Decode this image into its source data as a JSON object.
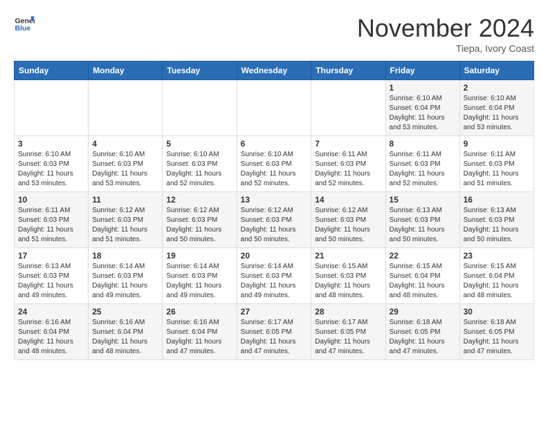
{
  "header": {
    "logo_general": "General",
    "logo_blue": "Blue",
    "month_title": "November 2024",
    "location": "Tiepa, Ivory Coast"
  },
  "days_of_week": [
    "Sunday",
    "Monday",
    "Tuesday",
    "Wednesday",
    "Thursday",
    "Friday",
    "Saturday"
  ],
  "weeks": [
    [
      {
        "day": "",
        "info": ""
      },
      {
        "day": "",
        "info": ""
      },
      {
        "day": "",
        "info": ""
      },
      {
        "day": "",
        "info": ""
      },
      {
        "day": "",
        "info": ""
      },
      {
        "day": "1",
        "info": "Sunrise: 6:10 AM\nSunset: 6:04 PM\nDaylight: 11 hours\nand 53 minutes."
      },
      {
        "day": "2",
        "info": "Sunrise: 6:10 AM\nSunset: 6:04 PM\nDaylight: 11 hours\nand 53 minutes."
      }
    ],
    [
      {
        "day": "3",
        "info": "Sunrise: 6:10 AM\nSunset: 6:03 PM\nDaylight: 11 hours\nand 53 minutes."
      },
      {
        "day": "4",
        "info": "Sunrise: 6:10 AM\nSunset: 6:03 PM\nDaylight: 11 hours\nand 53 minutes."
      },
      {
        "day": "5",
        "info": "Sunrise: 6:10 AM\nSunset: 6:03 PM\nDaylight: 11 hours\nand 52 minutes."
      },
      {
        "day": "6",
        "info": "Sunrise: 6:10 AM\nSunset: 6:03 PM\nDaylight: 11 hours\nand 52 minutes."
      },
      {
        "day": "7",
        "info": "Sunrise: 6:11 AM\nSunset: 6:03 PM\nDaylight: 11 hours\nand 52 minutes."
      },
      {
        "day": "8",
        "info": "Sunrise: 6:11 AM\nSunset: 6:03 PM\nDaylight: 11 hours\nand 52 minutes."
      },
      {
        "day": "9",
        "info": "Sunrise: 6:11 AM\nSunset: 6:03 PM\nDaylight: 11 hours\nand 51 minutes."
      }
    ],
    [
      {
        "day": "10",
        "info": "Sunrise: 6:11 AM\nSunset: 6:03 PM\nDaylight: 11 hours\nand 51 minutes."
      },
      {
        "day": "11",
        "info": "Sunrise: 6:12 AM\nSunset: 6:03 PM\nDaylight: 11 hours\nand 51 minutes."
      },
      {
        "day": "12",
        "info": "Sunrise: 6:12 AM\nSunset: 6:03 PM\nDaylight: 11 hours\nand 50 minutes."
      },
      {
        "day": "13",
        "info": "Sunrise: 6:12 AM\nSunset: 6:03 PM\nDaylight: 11 hours\nand 50 minutes."
      },
      {
        "day": "14",
        "info": "Sunrise: 6:12 AM\nSunset: 6:03 PM\nDaylight: 11 hours\nand 50 minutes."
      },
      {
        "day": "15",
        "info": "Sunrise: 6:13 AM\nSunset: 6:03 PM\nDaylight: 11 hours\nand 50 minutes."
      },
      {
        "day": "16",
        "info": "Sunrise: 6:13 AM\nSunset: 6:03 PM\nDaylight: 11 hours\nand 50 minutes."
      }
    ],
    [
      {
        "day": "17",
        "info": "Sunrise: 6:13 AM\nSunset: 6:03 PM\nDaylight: 11 hours\nand 49 minutes."
      },
      {
        "day": "18",
        "info": "Sunrise: 6:14 AM\nSunset: 6:03 PM\nDaylight: 11 hours\nand 49 minutes."
      },
      {
        "day": "19",
        "info": "Sunrise: 6:14 AM\nSunset: 6:03 PM\nDaylight: 11 hours\nand 49 minutes."
      },
      {
        "day": "20",
        "info": "Sunrise: 6:14 AM\nSunset: 6:03 PM\nDaylight: 11 hours\nand 49 minutes."
      },
      {
        "day": "21",
        "info": "Sunrise: 6:15 AM\nSunset: 6:03 PM\nDaylight: 11 hours\nand 48 minutes."
      },
      {
        "day": "22",
        "info": "Sunrise: 6:15 AM\nSunset: 6:04 PM\nDaylight: 11 hours\nand 48 minutes."
      },
      {
        "day": "23",
        "info": "Sunrise: 6:15 AM\nSunset: 6:04 PM\nDaylight: 11 hours\nand 48 minutes."
      }
    ],
    [
      {
        "day": "24",
        "info": "Sunrise: 6:16 AM\nSunset: 6:04 PM\nDaylight: 11 hours\nand 48 minutes."
      },
      {
        "day": "25",
        "info": "Sunrise: 6:16 AM\nSunset: 6:04 PM\nDaylight: 11 hours\nand 48 minutes."
      },
      {
        "day": "26",
        "info": "Sunrise: 6:16 AM\nSunset: 6:04 PM\nDaylight: 11 hours\nand 47 minutes."
      },
      {
        "day": "27",
        "info": "Sunrise: 6:17 AM\nSunset: 6:05 PM\nDaylight: 11 hours\nand 47 minutes."
      },
      {
        "day": "28",
        "info": "Sunrise: 6:17 AM\nSunset: 6:05 PM\nDaylight: 11 hours\nand 47 minutes."
      },
      {
        "day": "29",
        "info": "Sunrise: 6:18 AM\nSunset: 6:05 PM\nDaylight: 11 hours\nand 47 minutes."
      },
      {
        "day": "30",
        "info": "Sunrise: 6:18 AM\nSunset: 6:05 PM\nDaylight: 11 hours\nand 47 minutes."
      }
    ]
  ]
}
